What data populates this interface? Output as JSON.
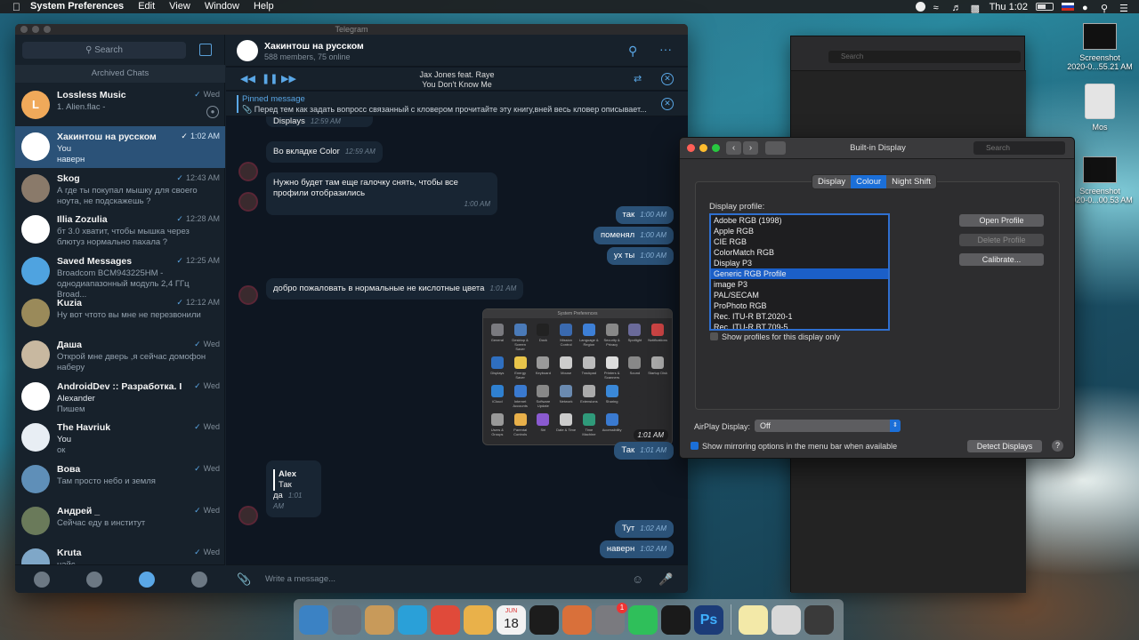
{
  "menubar": {
    "app": "System Preferences",
    "items": [
      "Edit",
      "View",
      "Window",
      "Help"
    ],
    "clock": "Thu 1:02"
  },
  "desktop": [
    {
      "label1": "Screenshot",
      "label2": "2020-0...55.21 AM"
    },
    {
      "label1": "Mos",
      "label2": ""
    },
    {
      "label1": "Screenshot",
      "label2": "2020-0...00.53 AM"
    }
  ],
  "telegram": {
    "window_title": "Telegram",
    "search_placeholder": "Search",
    "archived_label": "Archived Chats",
    "chats": [
      {
        "name": "Lossless Music",
        "time": "Wed",
        "msg": "1. Alien.flac -",
        "initial": "L",
        "color": "#f0a95a",
        "pinned": true
      },
      {
        "name": "Хакинтош на русском",
        "time": "1:02 AM",
        "msg_sender": "You",
        "msg": "наверн",
        "initial": "",
        "color": "#ffffff",
        "selected": true
      },
      {
        "name": "Skog",
        "time": "12:43 AM",
        "msg": "А где ты покупал мышку для своего ноута, не подскажешь ?",
        "initial": "",
        "color": "#8a7a6a"
      },
      {
        "name": "Illia Zozulia",
        "time": "12:28 AM",
        "msg": "бт 3.0 хватит, чтобы мышка через блютуз нормально пахала ?",
        "initial": "",
        "color": "#ffffff"
      },
      {
        "name": "Saved Messages",
        "time": "12:25 AM",
        "msg": "Broadcom BCM943225HM - однодиапазонный модуль 2,4 ГГц Broad...",
        "initial": "",
        "color": "#4fa3e0"
      },
      {
        "name": "Kuzia",
        "time": "12:12 AM",
        "msg": "Ну вот чтото вы мне не перезвонили",
        "initial": "",
        "color": "#9a8a5a"
      },
      {
        "name": "Даша",
        "time": "Wed",
        "msg": "Открой мне дверь ,я сейчас домофон наберу",
        "initial": "",
        "color": "#c8b8a0"
      },
      {
        "name": "AndroidDev :: Разработка. It's...",
        "time": "Wed",
        "msg_sender": "Alexander",
        "msg": "Пишем",
        "initial": "",
        "color": "#ffffff"
      },
      {
        "name": "The Havriuk",
        "time": "Wed",
        "msg_sender": "You",
        "msg": "ок",
        "initial": "",
        "color": "#e8eef4"
      },
      {
        "name": "Вова",
        "time": "Wed",
        "msg": "Там просто небо и земля",
        "initial": "",
        "color": "#5f8fb8"
      },
      {
        "name": "Андрей _",
        "time": "Wed",
        "msg": "Сейчас еду в институт",
        "initial": "",
        "color": "#6a7a5a"
      },
      {
        "name": "Kruta",
        "time": "Wed",
        "msg": "найс",
        "initial": "",
        "color": "#7fa7c8"
      }
    ],
    "header": {
      "title": "Хакинтош на русском",
      "subtitle": "588 members, 75 online"
    },
    "player": {
      "artist": "Jax Jones feat. Raye",
      "track": "You Don't Know Me"
    },
    "pinned": {
      "title": "Pinned message",
      "text": "Перед тем как задать вопросс связанный с кловером прочитайте эту книгу,вней весь кловер описывает..."
    },
    "messages": {
      "m0": {
        "text": "Displays",
        "time": "12:59 AM"
      },
      "m1": {
        "text": "Во вкладке Color",
        "time": "12:59 AM"
      },
      "m2": {
        "text": "Нужно будет там еще галочку снять, чтобы все профили отобразились",
        "time": "1:00 AM"
      },
      "o1": {
        "text": "так",
        "time": "1:00 AM"
      },
      "o2": {
        "text": "поменял",
        "time": "1:00 AM"
      },
      "o3": {
        "text": "ух ты",
        "time": "1:00 AM"
      },
      "m3": {
        "text": "добро пожаловать в нормальные не кислотные цвета",
        "time": "1:01 AM"
      },
      "shot_time": "1:01 AM",
      "o4": {
        "text": "Так",
        "time": "1:01 AM"
      },
      "reply": {
        "author": "Alex",
        "quote": "Так",
        "text": "да",
        "time": "1:01 AM"
      },
      "o5": {
        "text": "Тут",
        "time": "1:02 AM"
      },
      "o6": {
        "text": "наверн",
        "time": "1:02 AM"
      }
    },
    "composer_placeholder": "Write a message..."
  },
  "shot": {
    "title": "System Preferences",
    "icons": [
      "General",
      "Desktop & Screen Saver",
      "Dock",
      "Mission Control",
      "Language & Region",
      "Security & Privacy",
      "Spotlight",
      "Notifications",
      "Displays",
      "Energy Saver",
      "Keyboard",
      "Mouse",
      "Trackpad",
      "Printers & Scanners",
      "Sound",
      "Startup Disk",
      "iCloud",
      "Internet Accounts",
      "Software Update",
      "Network",
      "Extensions",
      "Sharing",
      "",
      "",
      "Users & Groups",
      "Parental Controls",
      "Siri",
      "Date & Time",
      "Time Machine",
      "Accessibility",
      "",
      ""
    ]
  },
  "bg_search": "Search",
  "display": {
    "title": "Built-in Display",
    "search": "Search",
    "tabs": [
      "Display",
      "Colour",
      "Night Shift"
    ],
    "profile_label": "Display profile:",
    "profiles": [
      "Adobe RGB (1998)",
      "Apple RGB",
      "CIE RGB",
      "ColorMatch RGB",
      "Display P3",
      "Generic RGB Profile",
      "image P3",
      "PAL/SECAM",
      "ProPhoto RGB",
      "Rec. ITU-R BT.2020-1",
      "Rec. ITU-R BT.709-5"
    ],
    "selected_profile": "Generic RGB Profile",
    "show_only": "Show profiles for this display only",
    "open_profile": "Open Profile",
    "delete_profile": "Delete Profile",
    "calibrate": "Calibrate...",
    "airplay_label": "AirPlay Display:",
    "airplay_value": "Off",
    "mirroring": "Show mirroring options in the menu bar when available",
    "detect": "Detect Displays",
    "help": "?"
  },
  "dock": {
    "colors": [
      "#3b82c4",
      "#6a6f78",
      "#c89a5a",
      "#2aa0d8",
      "#e04a3a",
      "#e9b14a",
      "#f2f2f2",
      "#1c1c1c",
      "#d9703a",
      "#7a7a7f",
      "#2fbf5a",
      "#1a1a1a",
      "#1c3c78",
      "#f3e9a8",
      "#d8d8d8",
      "#3a3a3a"
    ],
    "badge": "1",
    "calendar_month": "JUN",
    "calendar_day": "18",
    "ps_label": "Ps"
  }
}
